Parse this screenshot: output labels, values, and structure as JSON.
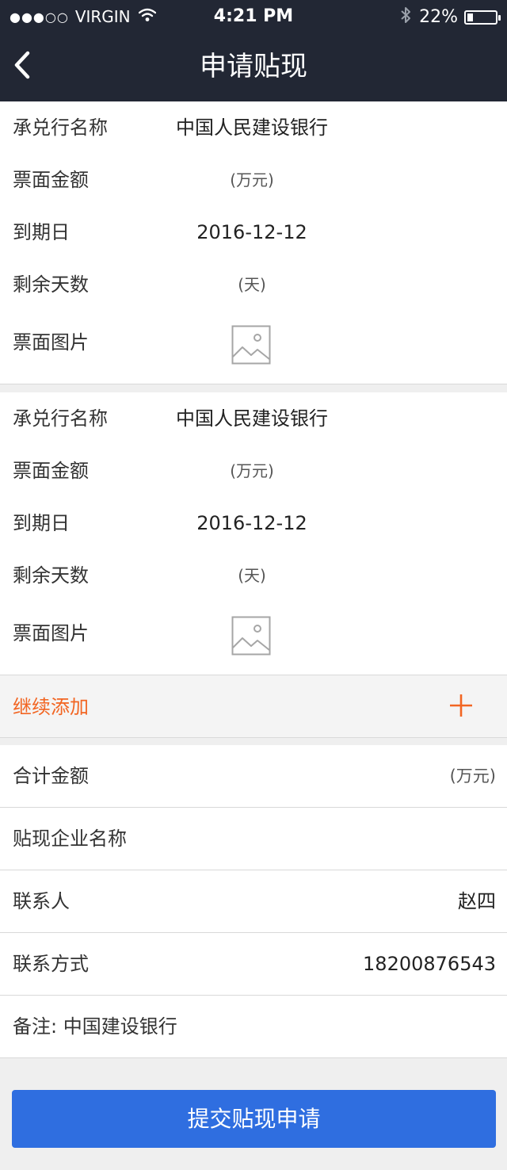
{
  "status_bar": {
    "signal_dots": "●●●○○",
    "carrier": "VIRGIN",
    "time": "4:21 PM",
    "battery_percent": "22%",
    "battery_level": 0.22
  },
  "nav": {
    "title": "申请贴现"
  },
  "bills": [
    {
      "bank_label": "承兑行名称",
      "bank_value": "中国人民建设银行",
      "amount_label": "票面金额",
      "amount_unit": "(万元)",
      "due_label": "到期日",
      "due_value": "2016-12-12",
      "days_label": "剩余天数",
      "days_unit": "(天)",
      "image_label": "票面图片"
    },
    {
      "bank_label": "承兑行名称",
      "bank_value": "中国人民建设银行",
      "amount_label": "票面金额",
      "amount_unit": "(万元)",
      "due_label": "到期日",
      "due_value": "2016-12-12",
      "days_label": "剩余天数",
      "days_unit": "(天)",
      "image_label": "票面图片"
    }
  ],
  "add_more": {
    "label": "继续添加"
  },
  "summary": {
    "total_label": "合计金额",
    "total_unit": "(万元)",
    "company_label": "贴现企业名称",
    "contact_label": "联系人",
    "contact_value": "赵四",
    "phone_label": "联系方式",
    "phone_value": "18200876543",
    "remark_label": "备注:",
    "remark_value": "中国建设银行"
  },
  "submit": {
    "label": "提交贴现申请"
  },
  "colors": {
    "header_bg": "#222734",
    "accent_orange": "#f26522",
    "button_blue": "#2f6ee0"
  },
  "icons": {
    "back": "chevron-left-icon",
    "image": "image-placeholder-icon",
    "add": "plus-icon",
    "wifi": "wifi-icon",
    "bluetooth": "bluetooth-icon",
    "battery": "battery-icon"
  }
}
